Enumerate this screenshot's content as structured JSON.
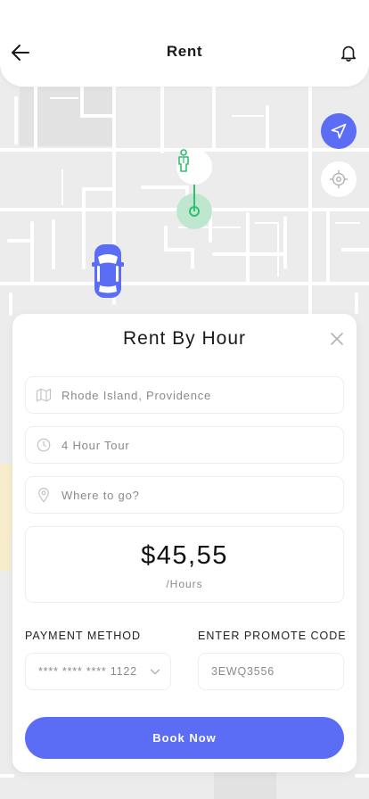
{
  "header": {
    "title": "Rent",
    "back_icon": "arrow-left-icon",
    "notification_icon": "bell-icon"
  },
  "map": {
    "navigate_icon": "navigation-arrow-icon",
    "locate_icon": "crosshair-icon",
    "driver_marker_icon": "person-pin-icon",
    "car_icon": "car-icon",
    "accent_color": "#5b6cf5",
    "route_color": "#2fbf71"
  },
  "sheet": {
    "title": "Rent By Hour",
    "close_icon": "close-icon",
    "fields": [
      {
        "icon": "map-icon",
        "value": "Rhode Island, Providence"
      },
      {
        "icon": "clock-icon",
        "value": "4 Hour Tour"
      },
      {
        "icon": "location-pin-icon",
        "placeholder": "Where to go?"
      }
    ],
    "price": "$45,55",
    "price_unit": "/Hours",
    "payment_label": "PAYMENT METHOD",
    "payment_value": "**** **** **** 1122",
    "promo_label": "ENTER PROMOTE CODE",
    "promo_value": "3EWQ3556",
    "book_button": "Book Now"
  }
}
